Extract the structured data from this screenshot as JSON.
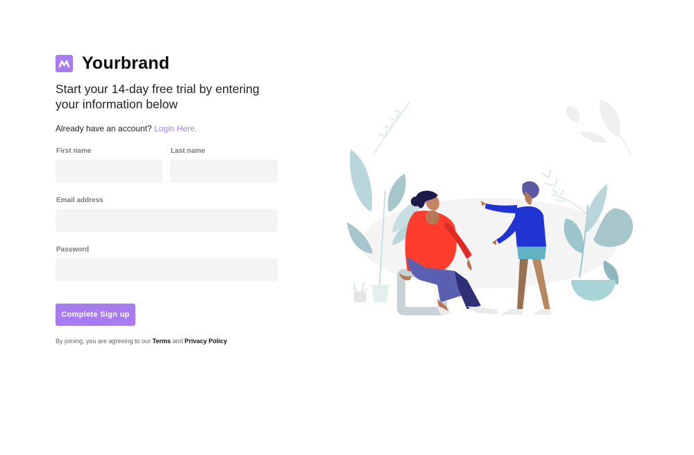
{
  "brand": {
    "name": "Yourbrand",
    "logo_icon": "brand-logo-icon",
    "accent_color": "#a87cf0"
  },
  "headline": "Start your 14-day free trial by entering your information below",
  "account": {
    "prompt": "Already have an account?",
    "login_link": "Login Here."
  },
  "form": {
    "first_name_label": "First name",
    "last_name_label": "Last name",
    "email_label": "Email address",
    "password_label": "Password",
    "submit_label": "Complete Sign up"
  },
  "legal": {
    "prefix": "By joining, you are agreeing to our",
    "terms": "Terms",
    "and": "and",
    "privacy": "Privacy Policy"
  },
  "illustration": {
    "icon": "people-meeting-illustration"
  }
}
